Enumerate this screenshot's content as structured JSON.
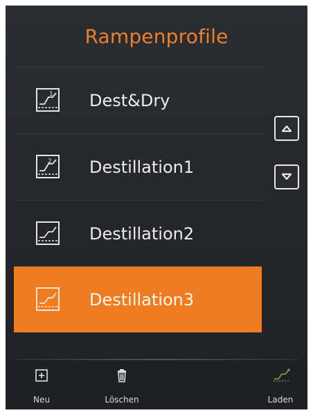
{
  "header": {
    "title": "Rampenprofile",
    "title_color": "#EE7F2D"
  },
  "list": {
    "selected_color": "#F07C22",
    "items": [
      {
        "label": "Dest&Dry",
        "icon": "ramp-profile-1-icon",
        "selected": false
      },
      {
        "label": "Destillation1",
        "icon": "ramp-profile-2-icon",
        "selected": false
      },
      {
        "label": "Destillation2",
        "icon": "ramp-profile-icon",
        "selected": false
      },
      {
        "label": "Destillation3",
        "icon": "ramp-profile-icon",
        "selected": true
      }
    ]
  },
  "scroll": {
    "up_icon": "triangle-up-icon",
    "down_icon": "triangle-down-icon"
  },
  "toolbar": {
    "new_label": "Neu",
    "delete_label": "Löschen",
    "load_label": "Laden",
    "new_icon": "plus-box-icon",
    "delete_icon": "trash-icon",
    "load_icon": "ramp-load-icon",
    "load_icon_color": "#5E8F3A"
  }
}
